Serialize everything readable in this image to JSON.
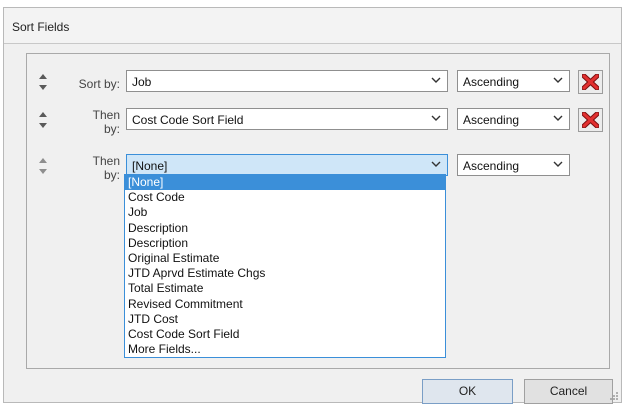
{
  "dialog": {
    "title": "Sort Fields"
  },
  "rows": [
    {
      "label": "Sort by:",
      "field": "Job",
      "order": "Ascending",
      "deletable": true
    },
    {
      "label_line1": "Then",
      "label_line2": "by:",
      "field": "Cost Code Sort Field",
      "order": "Ascending",
      "deletable": true
    },
    {
      "label_line1": "Then",
      "label_line2": "by:",
      "field": "[None]",
      "order": "Ascending",
      "deletable": false
    }
  ],
  "dropdown": {
    "options": [
      "[None]",
      "Cost Code",
      "Job",
      "Description",
      "Description",
      "Original Estimate",
      "JTD Aprvd Estimate Chgs",
      "Total Estimate",
      "Revised Commitment",
      "JTD Cost",
      "Cost Code Sort Field",
      "More Fields..."
    ],
    "selected_index": 0
  },
  "buttons": {
    "ok": "OK",
    "cancel": "Cancel"
  },
  "colors": {
    "accent": "#3b8fd9",
    "delete_red": "#d42a2a"
  }
}
